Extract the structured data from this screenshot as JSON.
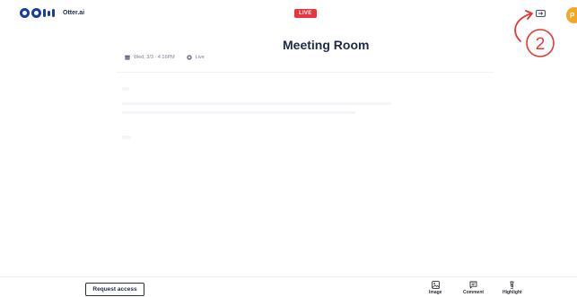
{
  "app": {
    "brand": "Otter.ai",
    "live_label": "LIVE"
  },
  "meeting": {
    "title": "Meeting Room",
    "date": "Wed, 3/3 · 4:16PM",
    "status": "Live"
  },
  "annotation": {
    "number": "2",
    "color": "#e53935"
  },
  "user": {
    "avatar_initial": "P",
    "avatar_color": "#f5a623"
  },
  "footer": {
    "request_access_label": "Request access",
    "tools": [
      {
        "label": "Image",
        "icon": "image-icon"
      },
      {
        "label": "Comment",
        "icon": "comment-icon"
      },
      {
        "label": "Highlight",
        "icon": "highlight-icon"
      }
    ]
  },
  "colors": {
    "brand": "#1a3d99",
    "live": "#e8343c"
  }
}
